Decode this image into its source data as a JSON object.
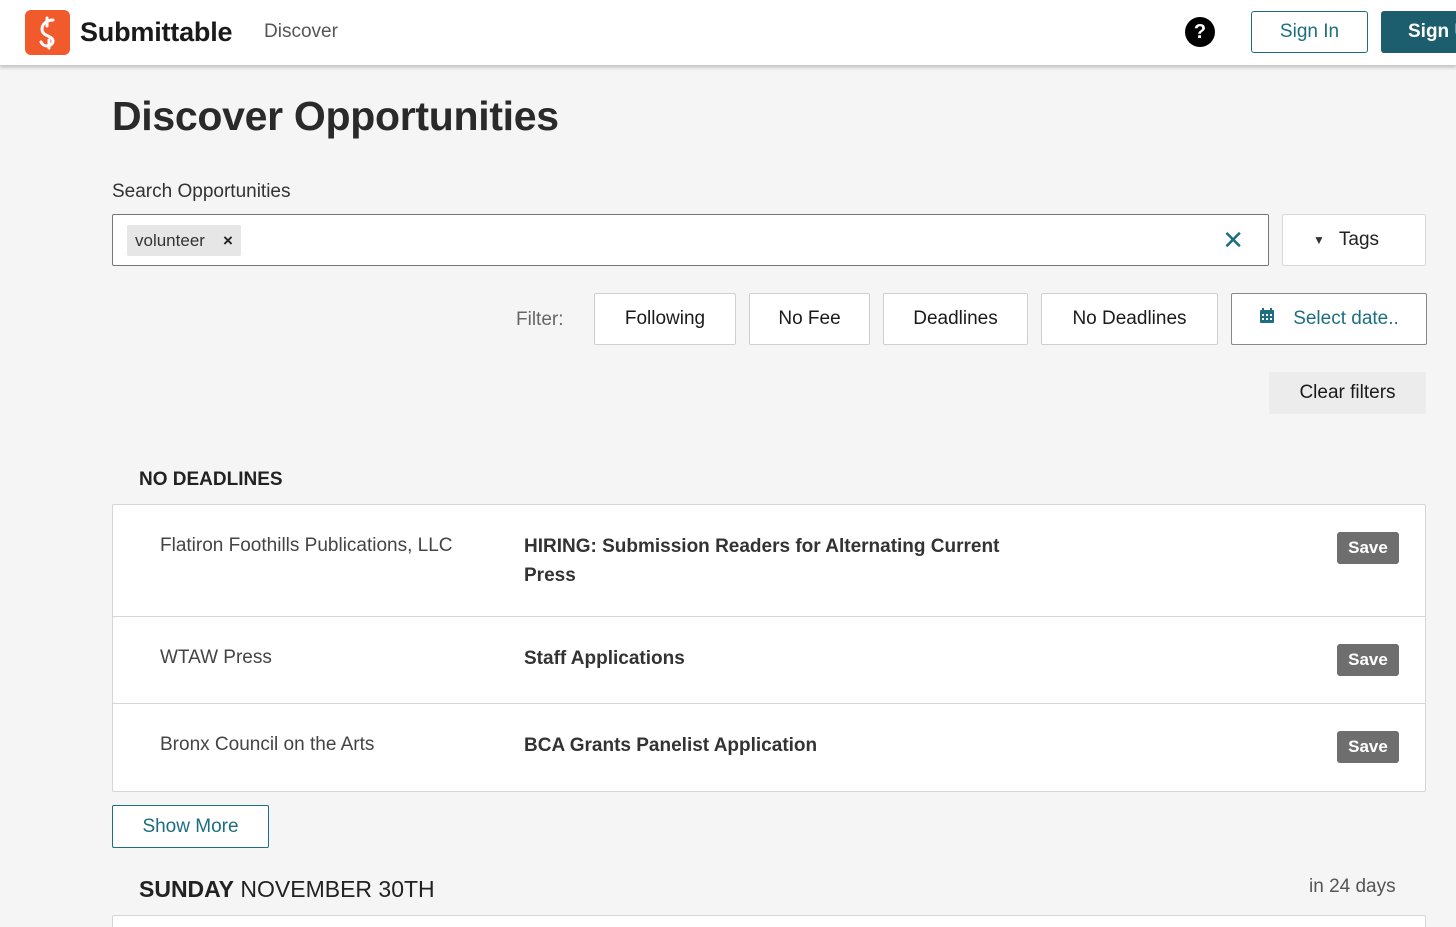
{
  "header": {
    "brand": "Submittable",
    "nav_discover": "Discover",
    "help": "?",
    "sign_in": "Sign In",
    "sign_up": "Sign Up"
  },
  "page": {
    "title": "Discover Opportunities",
    "search_label": "Search Opportunities",
    "search_chip": "volunteer",
    "search_chip_remove": "×",
    "search_clear": "✕",
    "tags_label": "Tags"
  },
  "filters": {
    "label": "Filter:",
    "items": [
      "Following",
      "No Fee",
      "Deadlines",
      "No Deadlines"
    ],
    "date_placeholder": "Select date..",
    "clear": "Clear filters"
  },
  "sections": [
    {
      "heading": "NO DEADLINES",
      "rows": [
        {
          "org": "Flatiron Foothills Publications, LLC",
          "title": "HIRING: Submission Readers for Alternating Current Press",
          "save": "Save"
        },
        {
          "org": "WTAW Press",
          "title": "Staff Applications",
          "save": "Save"
        },
        {
          "org": "Bronx Council on the Arts",
          "title": "BCA Grants Panelist Application",
          "save": "Save"
        }
      ],
      "show_more": "Show More"
    },
    {
      "heading_day": "SUNDAY",
      "heading_date": "NOVEMBER 30TH",
      "relative": "in 24 days"
    }
  ],
  "colors": {
    "brand_orange": "#f15a2b",
    "accent_teal": "#1d6e80",
    "save_gray": "#6e6e6e"
  }
}
